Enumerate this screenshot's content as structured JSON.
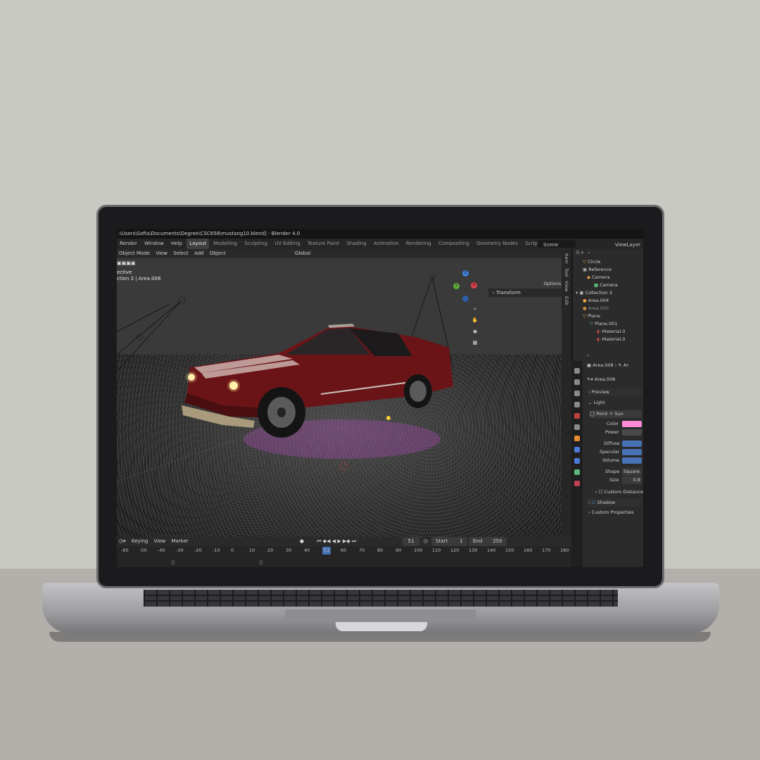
{
  "window": {
    "title": ":\\Users\\Sofia\\Documents\\Degree\\CSC658\\mustang10.blend] - Blender 4.0"
  },
  "menu": [
    "Render",
    "Window",
    "Help"
  ],
  "workspaces": [
    "Layout",
    "Modelling",
    "Sculpting",
    "UV Editing",
    "Texture Paint",
    "Shading",
    "Animation",
    "Rendering",
    "Compositing",
    "Geometry Nodes",
    "Scripting",
    "+"
  ],
  "active_workspace": "Layout",
  "scene": {
    "label": "Scene",
    "view_layer": "ViewLayer"
  },
  "viewport": {
    "mode": "Object Mode",
    "menus": [
      "View",
      "Select",
      "Add",
      "Object"
    ],
    "orientation": "Global",
    "overlay_text_1": "ective",
    "overlay_text_2": "ction 3 | Area.008",
    "options": "Options",
    "transform_panel": "Transform",
    "side_tabs": [
      "Item",
      "Tool",
      "View",
      "Edit"
    ],
    "axis": {
      "x": "X",
      "y": "Y",
      "z": "Z"
    }
  },
  "outliner": {
    "rows": [
      {
        "label": "Circle"
      },
      {
        "label": "Reference"
      },
      {
        "label": "Camera"
      },
      {
        "label": "Camera"
      },
      {
        "label": "Collection 3"
      },
      {
        "label": "Area.004"
      },
      {
        "label": "Area.005"
      },
      {
        "label": "Plane"
      },
      {
        "label": "Plane.001"
      },
      {
        "label": "Material.0"
      },
      {
        "label": "Material.0"
      }
    ]
  },
  "properties": {
    "breadcrumb_1": "Area.008",
    "breadcrumb_2": "Ar",
    "datablock": "Area.008",
    "sections": {
      "preview": "Preview",
      "light": "Light",
      "shadow": "Shadow",
      "custom_properties": "Custom Properties"
    },
    "light_types": [
      "Point",
      "Sun"
    ],
    "fields": {
      "color": "Color",
      "power": "Power",
      "diffuse": "Diffuse",
      "specular": "Specular",
      "volume": "Volume",
      "shape": "Shape",
      "shape_value": "Square",
      "size": "Size",
      "size_value": "0.8",
      "custom_distance": "Custom Distance"
    },
    "colors": {
      "light_color": "#ff8ad8",
      "slider": "#4772b3"
    }
  },
  "timeline": {
    "menus": [
      "Keying",
      "View",
      "Marker"
    ],
    "current_frame": "51",
    "start_label": "Start",
    "start": "1",
    "end_label": "End",
    "end": "250",
    "ruler": [
      "-60",
      "-50",
      "-40",
      "-30",
      "-20",
      "-10",
      "0",
      "10",
      "20",
      "30",
      "40",
      "51",
      "60",
      "70",
      "80",
      "90",
      "100",
      "110",
      "120",
      "130",
      "140",
      "150",
      "160",
      "170",
      "180"
    ]
  }
}
